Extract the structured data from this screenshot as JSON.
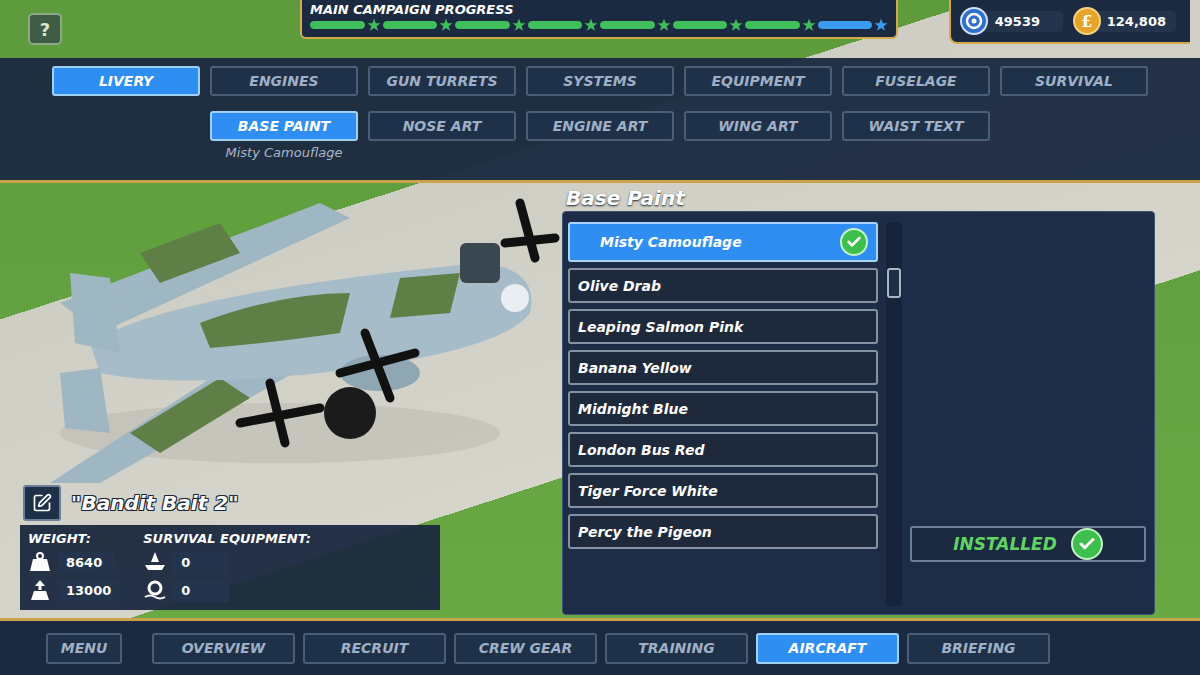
{
  "help_button": "?",
  "campaign": {
    "title": "MAIN CAMPAIGN PROGRESS",
    "segments": [
      {
        "complete": true,
        "level": 1
      },
      {
        "complete": true,
        "level": 1
      },
      {
        "complete": true,
        "level": 1
      },
      {
        "complete": true,
        "level": 1
      },
      {
        "complete": true,
        "level": 1
      },
      {
        "complete": true,
        "level": 1
      },
      {
        "complete": true,
        "level": 1
      },
      {
        "complete": false,
        "level": 1
      }
    ]
  },
  "currencies": [
    {
      "kind": "intel",
      "value": "49539"
    },
    {
      "kind": "money",
      "symbol": "£",
      "value": "124,808"
    }
  ],
  "tabs": [
    {
      "label": "LIVERY",
      "selected": true
    },
    {
      "label": "ENGINES",
      "selected": false
    },
    {
      "label": "GUN TURRETS",
      "selected": false
    },
    {
      "label": "SYSTEMS",
      "selected": false
    },
    {
      "label": "EQUIPMENT",
      "selected": false
    },
    {
      "label": "FUSELAGE",
      "selected": false
    },
    {
      "label": "SURVIVAL",
      "selected": false
    }
  ],
  "subtabs": [
    {
      "label": "BASE PAINT",
      "selected": true,
      "value": "Misty Camouflage"
    },
    {
      "label": "NOSE ART",
      "selected": false
    },
    {
      "label": "ENGINE ART",
      "selected": false
    },
    {
      "label": "WING ART",
      "selected": false
    },
    {
      "label": "WAIST TEXT",
      "selected": false
    }
  ],
  "aircraft": {
    "name": "\"Bandit Bait 2\"",
    "weight_label": "WEIGHT:",
    "weights": [
      {
        "kind": "current",
        "value": "8640"
      },
      {
        "kind": "max",
        "value": "13000"
      }
    ],
    "survival_label": "SURVIVAL EQUIPMENT:",
    "survival": [
      {
        "kind": "dinghy",
        "value": "0"
      },
      {
        "kind": "lifering",
        "value": "0"
      }
    ]
  },
  "paint_panel": {
    "title": "Base Paint",
    "scrollbar": {
      "level": 0.12
    },
    "options": [
      {
        "label": "Misty Camouflage",
        "selected": true,
        "installed": true
      },
      {
        "label": "Olive Drab",
        "selected": false,
        "installed": false
      },
      {
        "label": "Leaping Salmon Pink",
        "selected": false,
        "installed": false
      },
      {
        "label": "Banana Yellow",
        "selected": false,
        "installed": false
      },
      {
        "label": "Midnight Blue",
        "selected": false,
        "installed": false
      },
      {
        "label": "London Bus Red",
        "selected": false,
        "installed": false
      },
      {
        "label": "Tiger Force White",
        "selected": false,
        "installed": false
      },
      {
        "label": "Percy the Pigeon",
        "selected": false,
        "installed": false
      }
    ],
    "status": "INSTALLED"
  },
  "nav": [
    {
      "label": "MENU",
      "selected": false
    },
    {
      "label": "OVERVIEW",
      "selected": false
    },
    {
      "label": "RECRUIT",
      "selected": false
    },
    {
      "label": "CREW GEAR",
      "selected": false
    },
    {
      "label": "TRAINING",
      "selected": false
    },
    {
      "label": "AIRCRAFT",
      "selected": true
    },
    {
      "label": "BRIEFING",
      "selected": false
    }
  ]
}
